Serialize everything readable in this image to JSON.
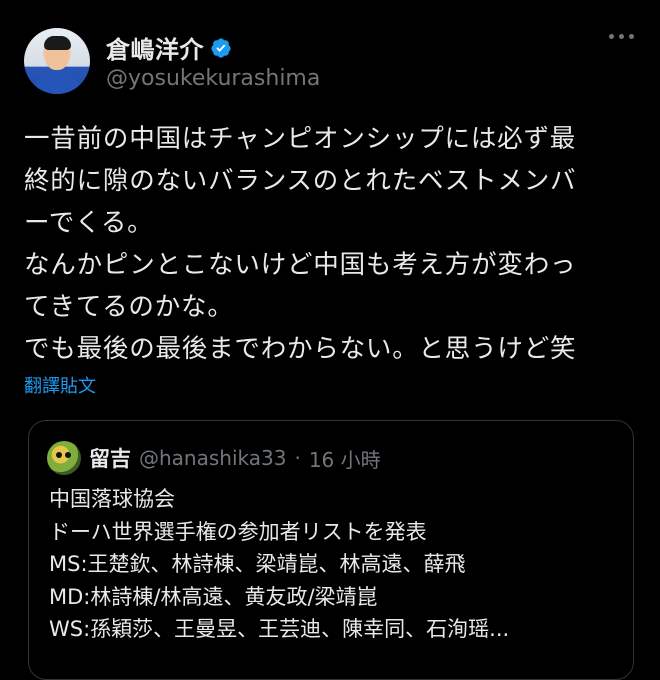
{
  "author": {
    "display_name": "倉嶋洋介",
    "handle": "@yosukekurashima",
    "verified_color": "#1d9bf0"
  },
  "tweet": {
    "lines": [
      "一昔前の中国はチャンピオンシップには必ず最",
      "終的に隙のないバランスのとれたベストメンバ",
      "ーでくる。",
      "なんかピンとこないけど中国も考え方が変わっ",
      "てきてるのかな。",
      "でも最後の最後までわからない。と思うけど笑"
    ],
    "translate_label": "翻譯貼文"
  },
  "quote": {
    "name": "留吉",
    "handle": "@hanashika33",
    "separator": "·",
    "time": "16 小時",
    "lines": [
      "中国落球協会",
      "ドーハ世界選手権の参加者リストを発表",
      "MS:王楚欽、林詩棟、梁靖崑、林高遠、薛飛",
      "MD:林詩棟/林高遠、黄友政/梁靖崑",
      "WS:孫穎莎、王曼昱、王芸迪、陳幸同、石洵瑶..."
    ]
  },
  "icons": {
    "more": "more-options-icon",
    "verified": "verified-badge-icon"
  },
  "colors": {
    "background": "#000000",
    "text_primary": "#e7e9ea",
    "text_secondary": "#71767b",
    "accent": "#1d9bf0",
    "border": "#2f3336"
  }
}
